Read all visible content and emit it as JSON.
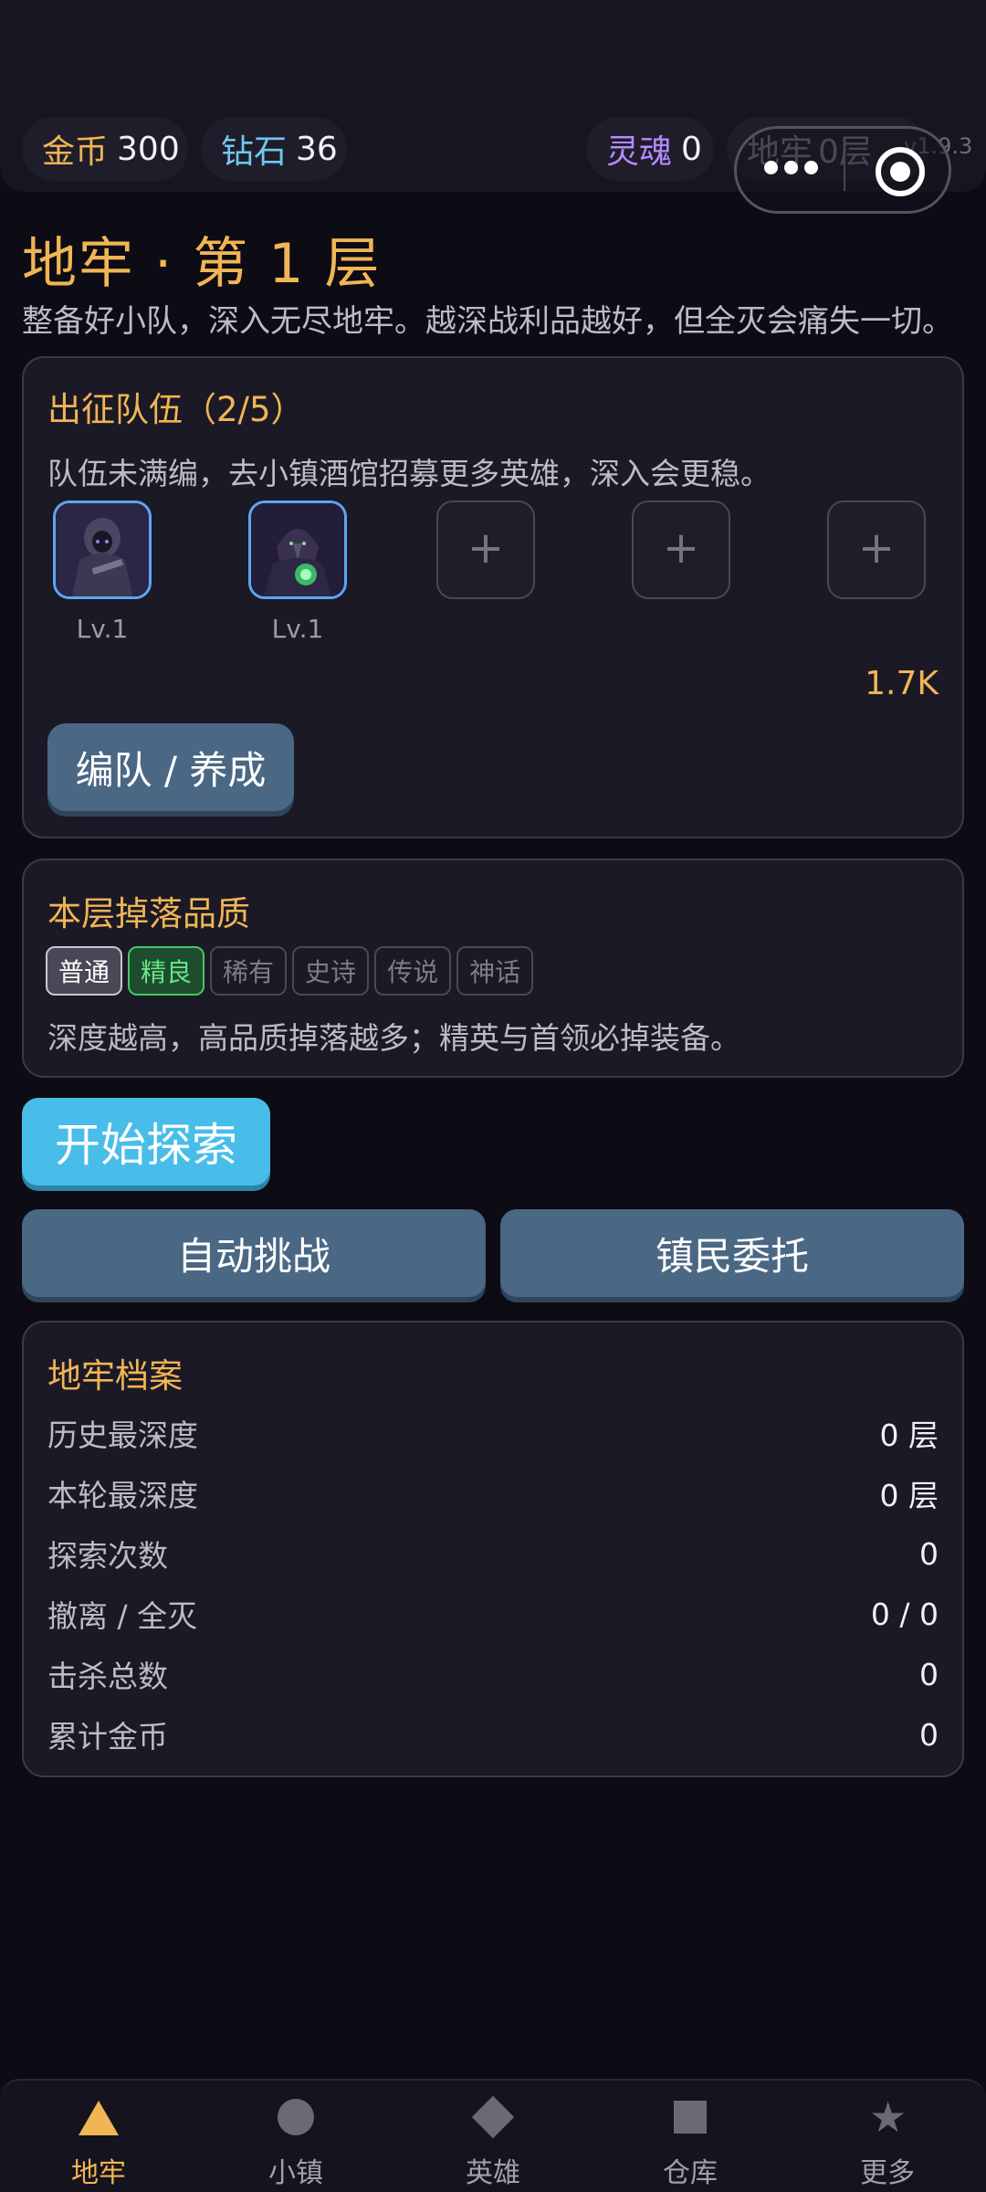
{
  "resources": {
    "gold_label": "金币",
    "gold_value": "300",
    "diamond_label": "钻石",
    "diamond_value": "36",
    "soul_label": "灵魂",
    "soul_value": "0",
    "floor_label": "地牢",
    "floor_value": "0层",
    "version": "v1.9.3"
  },
  "header": {
    "title": "地牢 · 第 1 层",
    "subtitle": "整备好小队，深入无尽地牢。越深战利品越好，但全灭会痛失一切。"
  },
  "team": {
    "title": "出征队伍（2/5）",
    "hint": "队伍未满编，去小镇酒馆招募更多英雄，深入会更稳。",
    "slots": [
      {
        "level": "Lv.1",
        "empty_symbol": ""
      },
      {
        "level": "Lv.1",
        "empty_symbol": ""
      },
      {
        "level": "",
        "empty_symbol": "+"
      },
      {
        "level": "",
        "empty_symbol": "+"
      },
      {
        "level": "",
        "empty_symbol": "+"
      }
    ],
    "power": "1.7K",
    "manage_button": "编队 / 养成"
  },
  "drops": {
    "title": "本层掉落品质",
    "tags": [
      "普通",
      "精良",
      "稀有",
      "史诗",
      "传说",
      "神话"
    ],
    "description": "深度越高，高品质掉落越多；精英与首领必掉装备。"
  },
  "actions": {
    "explore": "开始探索",
    "auto_challenge": "自动挑战",
    "entrust": "镇民委托"
  },
  "stats": {
    "title": "地牢档案",
    "rows": [
      {
        "label": "历史最深度",
        "value": "0 层"
      },
      {
        "label": "本轮最深度",
        "value": "0 层"
      },
      {
        "label": "探索次数",
        "value": "0"
      },
      {
        "label": "撤离 / 全灭",
        "value": "0 / 0"
      },
      {
        "label": "击杀总数",
        "value": "0"
      },
      {
        "label": "累计金币",
        "value": "0"
      }
    ]
  },
  "nav": [
    {
      "label": "地牢",
      "icon": "triangle-icon",
      "active": true
    },
    {
      "label": "小镇",
      "icon": "circle-icon"
    },
    {
      "label": "英雄",
      "icon": "diamond-icon"
    },
    {
      "label": "仓库",
      "icon": "square-icon"
    },
    {
      "label": "更多",
      "icon": "star-icon"
    }
  ],
  "colors": {
    "accent_gold": "#f0b555",
    "diamond_blue": "#6fc9ee",
    "soul_purple": "#b48aff",
    "explore_button": "#48bde9",
    "secondary_button": "#4a6784",
    "fine_quality": "#44c866",
    "background": "#0d0b14"
  }
}
